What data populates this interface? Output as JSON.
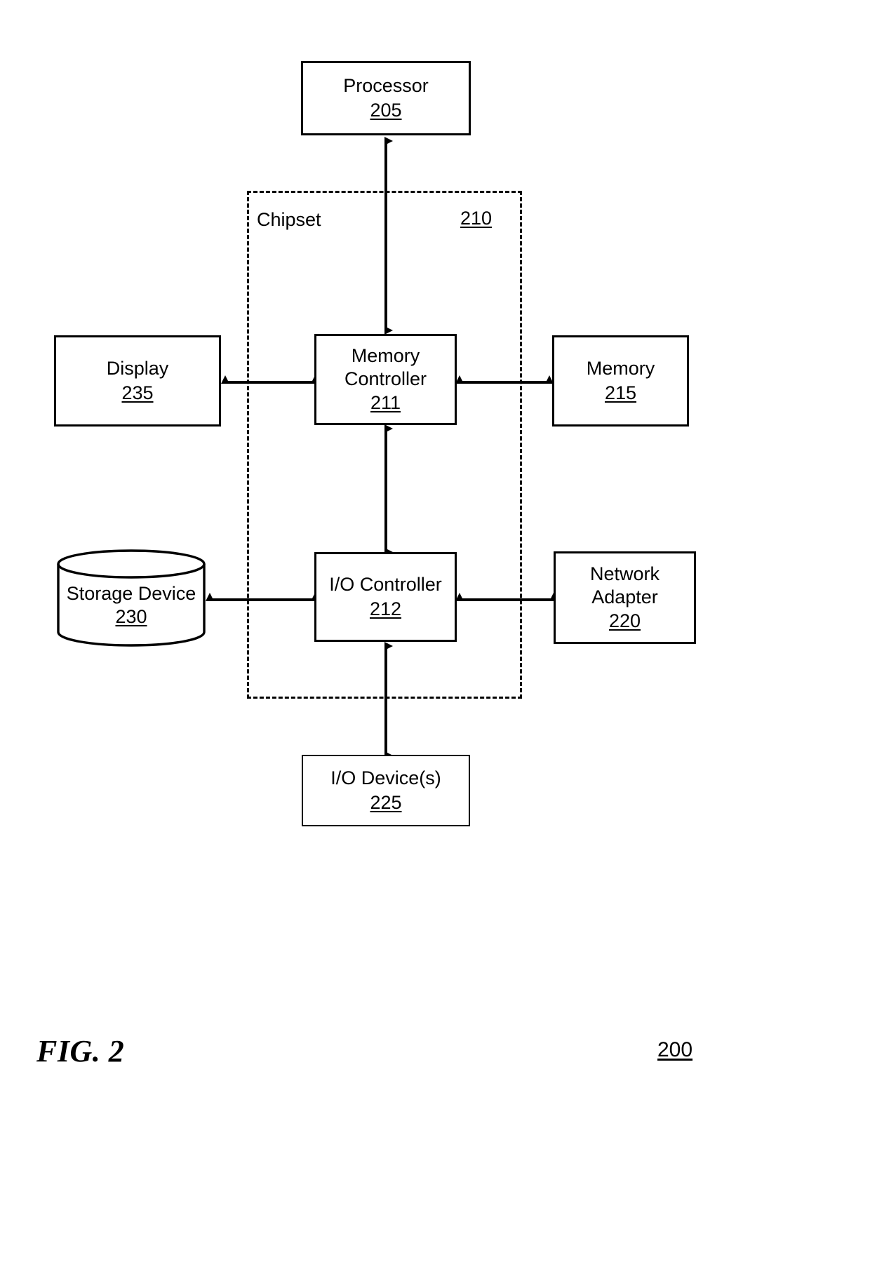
{
  "figure": {
    "caption": "FIG. 2",
    "reference_number": "200"
  },
  "chipset": {
    "label": "Chipset",
    "reference_number": "210"
  },
  "nodes": {
    "processor": {
      "label": "Processor",
      "reference_number": "205"
    },
    "memory_controller": {
      "label_line1": "Memory",
      "label_line2": "Controller",
      "reference_number": "211"
    },
    "io_controller": {
      "label": "I/O Controller",
      "reference_number": "212"
    },
    "display": {
      "label": "Display",
      "reference_number": "235"
    },
    "memory": {
      "label": "Memory",
      "reference_number": "215"
    },
    "storage_device": {
      "label": "Storage Device",
      "reference_number": "230"
    },
    "network_adapter": {
      "label_line1": "Network",
      "label_line2": "Adapter",
      "reference_number": "220"
    },
    "io_devices": {
      "label": "I/O Device(s)",
      "reference_number": "225"
    }
  },
  "connections": [
    {
      "name": "processor-to-memory-controller",
      "from": "processor",
      "to": "memory_controller",
      "style": "double-arrow"
    },
    {
      "name": "display-to-memory-controller",
      "from": "display",
      "to": "memory_controller",
      "style": "double-arrow"
    },
    {
      "name": "memory-controller-to-memory",
      "from": "memory_controller",
      "to": "memory",
      "style": "double-arrow"
    },
    {
      "name": "memory-controller-to-io-controller",
      "from": "memory_controller",
      "to": "io_controller",
      "style": "double-arrow"
    },
    {
      "name": "storage-device-to-io-controller",
      "from": "storage_device",
      "to": "io_controller",
      "style": "double-arrow"
    },
    {
      "name": "io-controller-to-network-adapter",
      "from": "io_controller",
      "to": "network_adapter",
      "style": "double-arrow"
    },
    {
      "name": "io-controller-to-io-devices",
      "from": "io_controller",
      "to": "io_devices",
      "style": "double-arrow"
    }
  ],
  "colors": {
    "stroke": "#000000",
    "background": "#ffffff"
  }
}
